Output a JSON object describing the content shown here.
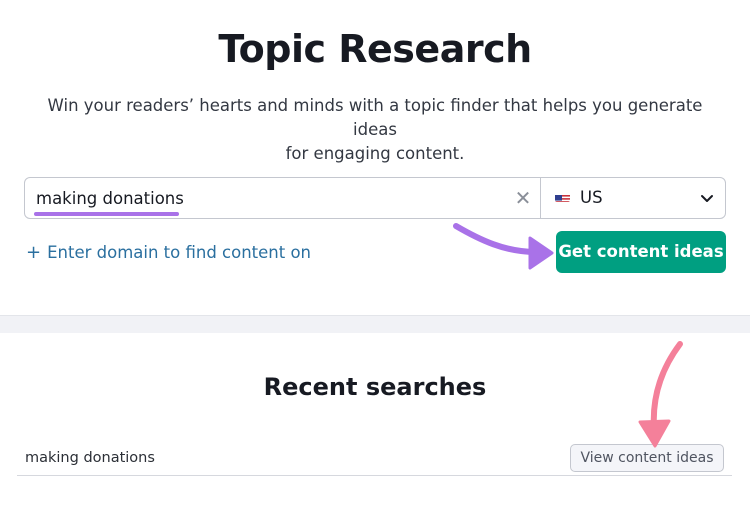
{
  "header": {
    "title": "Topic Research",
    "subtitle_line1": "Win your readers’ hearts and minds with a topic finder that helps you generate ideas",
    "subtitle_line2": "for engaging content."
  },
  "search": {
    "value": "making donations",
    "clear_icon": "close-icon",
    "country": "US",
    "country_flag": "us-flag-icon"
  },
  "actions": {
    "domain_link": "Enter domain to find content on",
    "domain_plus": "+",
    "cta_label": "Get content ideas"
  },
  "recent": {
    "title": "Recent searches",
    "items": [
      {
        "query": "making donations",
        "button_label": "View content ideas"
      }
    ]
  },
  "colors": {
    "accent": "#009f81",
    "link": "#2a6f9f",
    "highlight_purple": "#a972e8",
    "highlight_pink": "#f4809a"
  }
}
